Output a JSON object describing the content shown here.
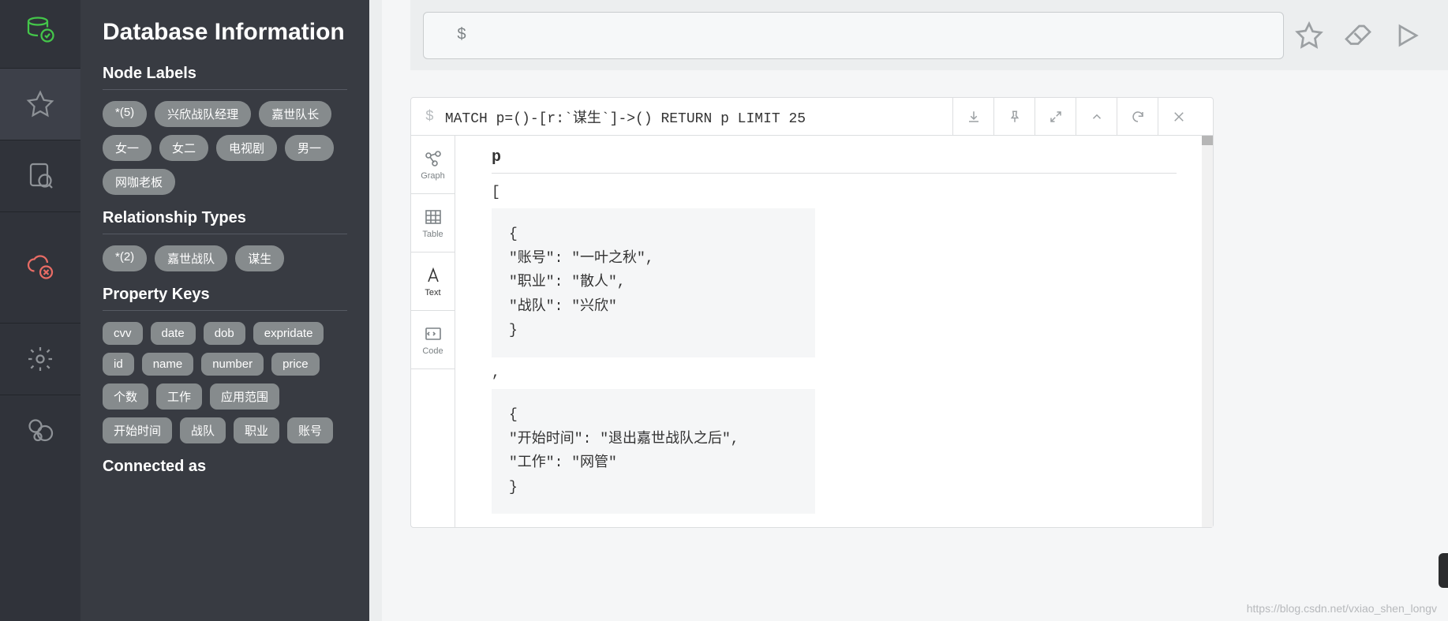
{
  "sidebar_title": "Database Information",
  "sections": {
    "node_labels": {
      "title": "Node Labels",
      "items": [
        "*(5)",
        "兴欣战队经理",
        "嘉世队长",
        "女一",
        "女二",
        "电视剧",
        "男一",
        "网咖老板"
      ]
    },
    "relationship_types": {
      "title": "Relationship Types",
      "items": [
        "*(2)",
        "嘉世战队",
        "谋生"
      ]
    },
    "property_keys": {
      "title": "Property Keys",
      "items": [
        "cvv",
        "date",
        "dob",
        "expridate",
        "id",
        "name",
        "number",
        "price",
        "个数",
        "工作",
        "应用范围",
        "开始时间",
        "战队",
        "职业",
        "账号"
      ]
    },
    "connected_as": {
      "title": "Connected as"
    }
  },
  "editor": {
    "prompt": "$"
  },
  "result": {
    "prompt": "$",
    "query": "MATCH p=()-[r:`谋生`]->() RETURN p LIMIT 25",
    "views": {
      "graph": "Graph",
      "table": "Table",
      "text": "Text",
      "code": "Code"
    },
    "column_header": "p",
    "bracket_open": "[",
    "comma": ",",
    "records": [
      "{\n\"账号\": \"一叶之秋\",\n\"职业\": \"散人\",\n\"战队\": \"兴欣\"\n}",
      "{\n\"开始时间\": \"退出嘉世战队之后\",\n\"工作\": \"网管\"\n}"
    ]
  },
  "watermark": "https://blog.csdn.net/vxiao_shen_longv"
}
